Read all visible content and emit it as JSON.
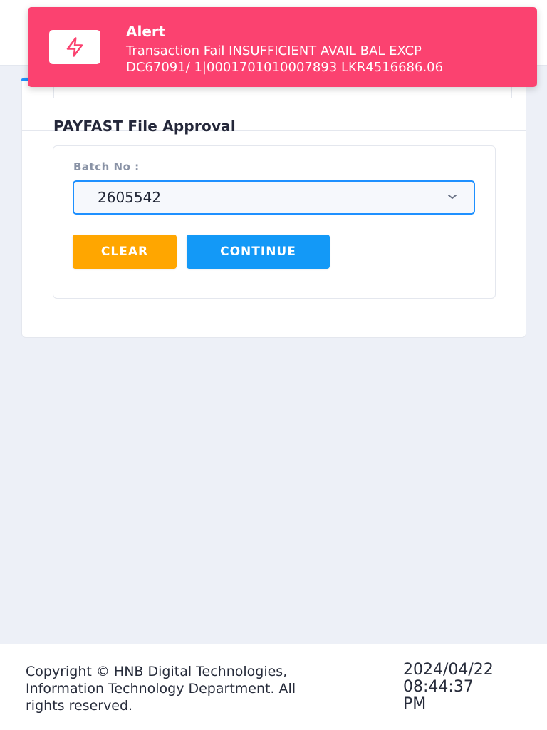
{
  "alert": {
    "title": "Alert",
    "message_line1": "Transaction Fail INSUFFICIENT AVAIL BAL EXCP",
    "message_line2": "DC67091/ 1|0001701010007893 LKR4516686.06",
    "icon": "lightning-icon",
    "color": "#fb4270"
  },
  "page": {
    "title": "PAYFAST File Approval"
  },
  "form": {
    "batch_label": "Batch No :",
    "batch_value": "2605542",
    "clear_label": "CLEAR",
    "continue_label": "CONTINUE"
  },
  "footer": {
    "copyright_line1": "Copyright © HNB Digital Technologies,",
    "copyright_line2": "Information Technology Department. All",
    "copyright_line3": "rights reserved.",
    "date": "2024/04/22",
    "time": "08:44:37",
    "ampm": "PM"
  },
  "colors": {
    "accent": "#1e90ff",
    "clear_button": "#ffa600",
    "continue_button": "#1399f7"
  }
}
